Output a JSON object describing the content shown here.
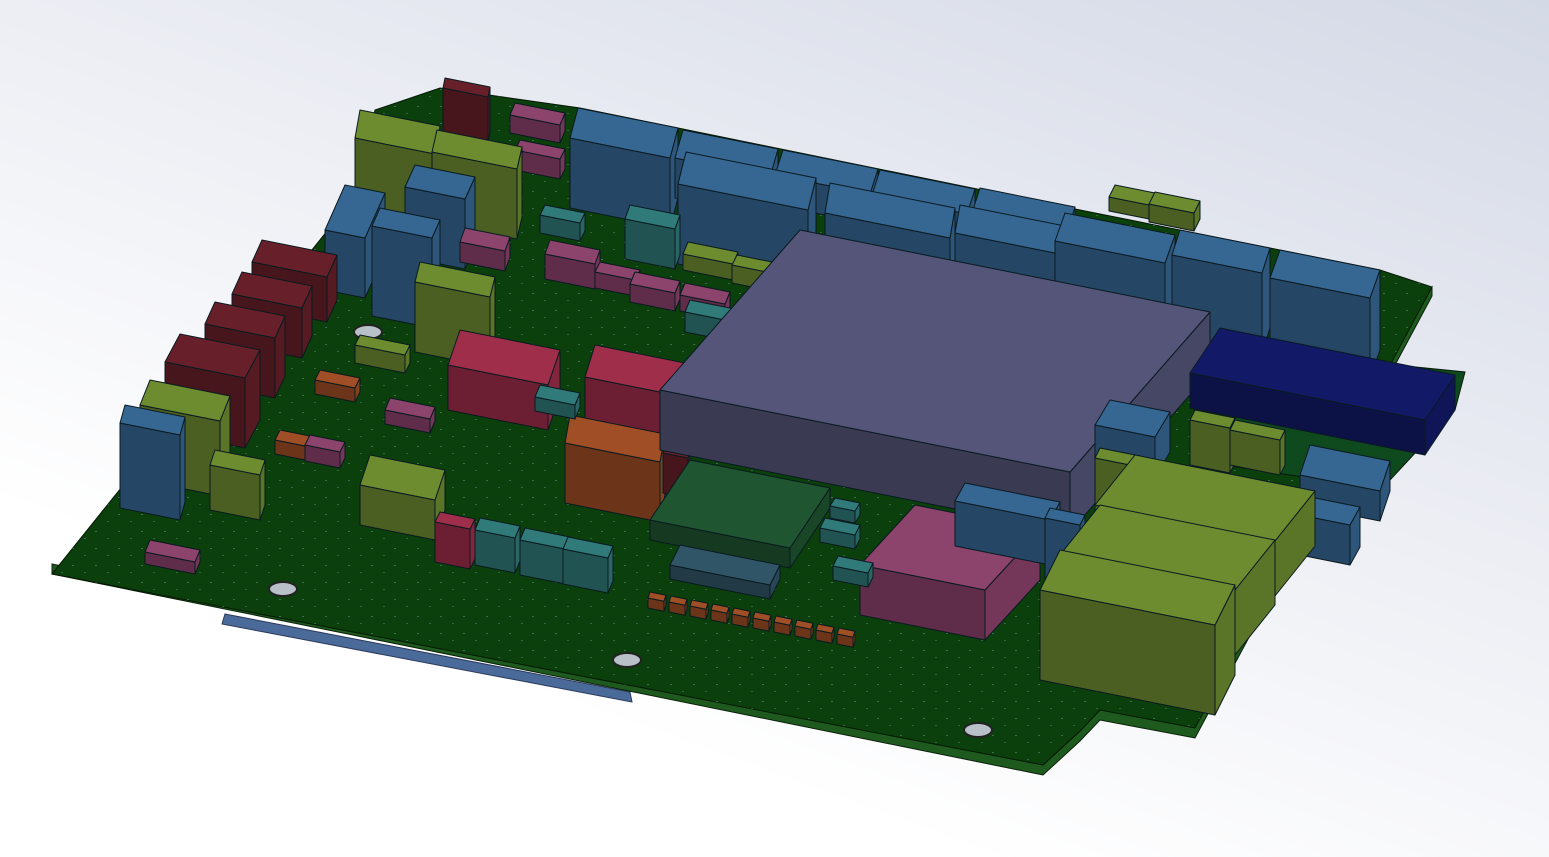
{
  "viewport": {
    "background_top": "#d4d9e6",
    "background_bottom": "#ffffff"
  },
  "model": {
    "icon": "pcb-board-3d-icon",
    "board_color": "#0b3f0b",
    "board_edge_color": "#1e5a1e",
    "colors": {
      "blue_connector": "#2f5a80",
      "olive": "#5f7a2a",
      "maroon": "#5a1c24",
      "pink": "#7a3a5e",
      "teal": "#2b6a6a",
      "crimson": "#8a2840",
      "brown": "#8a4420",
      "chip_gray": "#4a4a6a",
      "navy": "#10165a",
      "dark_green": "#1b4a2a"
    }
  }
}
